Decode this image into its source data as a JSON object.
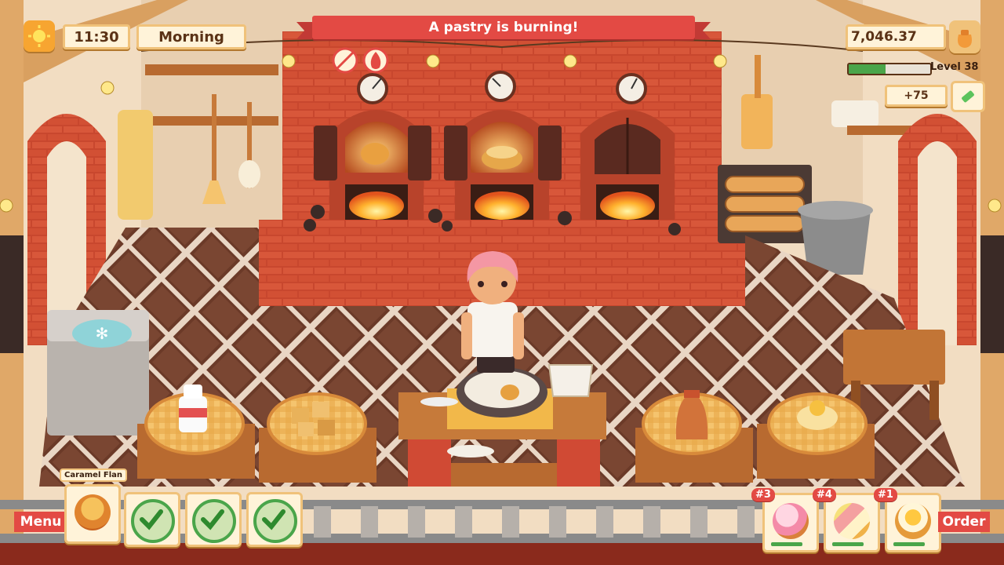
{
  "hud": {
    "time": "11:30",
    "period": "Morning",
    "alert": "A pastry is burning!",
    "money": "7,046.37",
    "level": "Level 38",
    "xp_progress": 0.45,
    "reward": "+75",
    "menu_label": "Menu",
    "order_label": "Order"
  },
  "recipe": {
    "name": "Caramel Flan",
    "steps_completed": 3
  },
  "orders": [
    {
      "rank": "#3",
      "icon": "cupcake-berry-icon",
      "progress": 0.8
    },
    {
      "rank": "#4",
      "icon": "skewer-icon",
      "progress": 0.8
    },
    {
      "rank": "#1",
      "icon": "egg-tart-icon",
      "progress": 0.8
    }
  ],
  "ovens": [
    {
      "name": "left-oven",
      "state": "burning",
      "pastry": "cream-puff"
    },
    {
      "name": "middle-oven",
      "state": "baking",
      "pastry": "cake"
    },
    {
      "name": "right-oven",
      "state": "closed",
      "pastry": ""
    }
  ],
  "colors": {
    "ribbon_red": "#e34a44",
    "panel_cream": "#fff3d9",
    "panel_border": "#f0c27a",
    "xp_green": "#4aa54a",
    "floor_dark": "#6b3a28",
    "brick": "#c8472e"
  }
}
